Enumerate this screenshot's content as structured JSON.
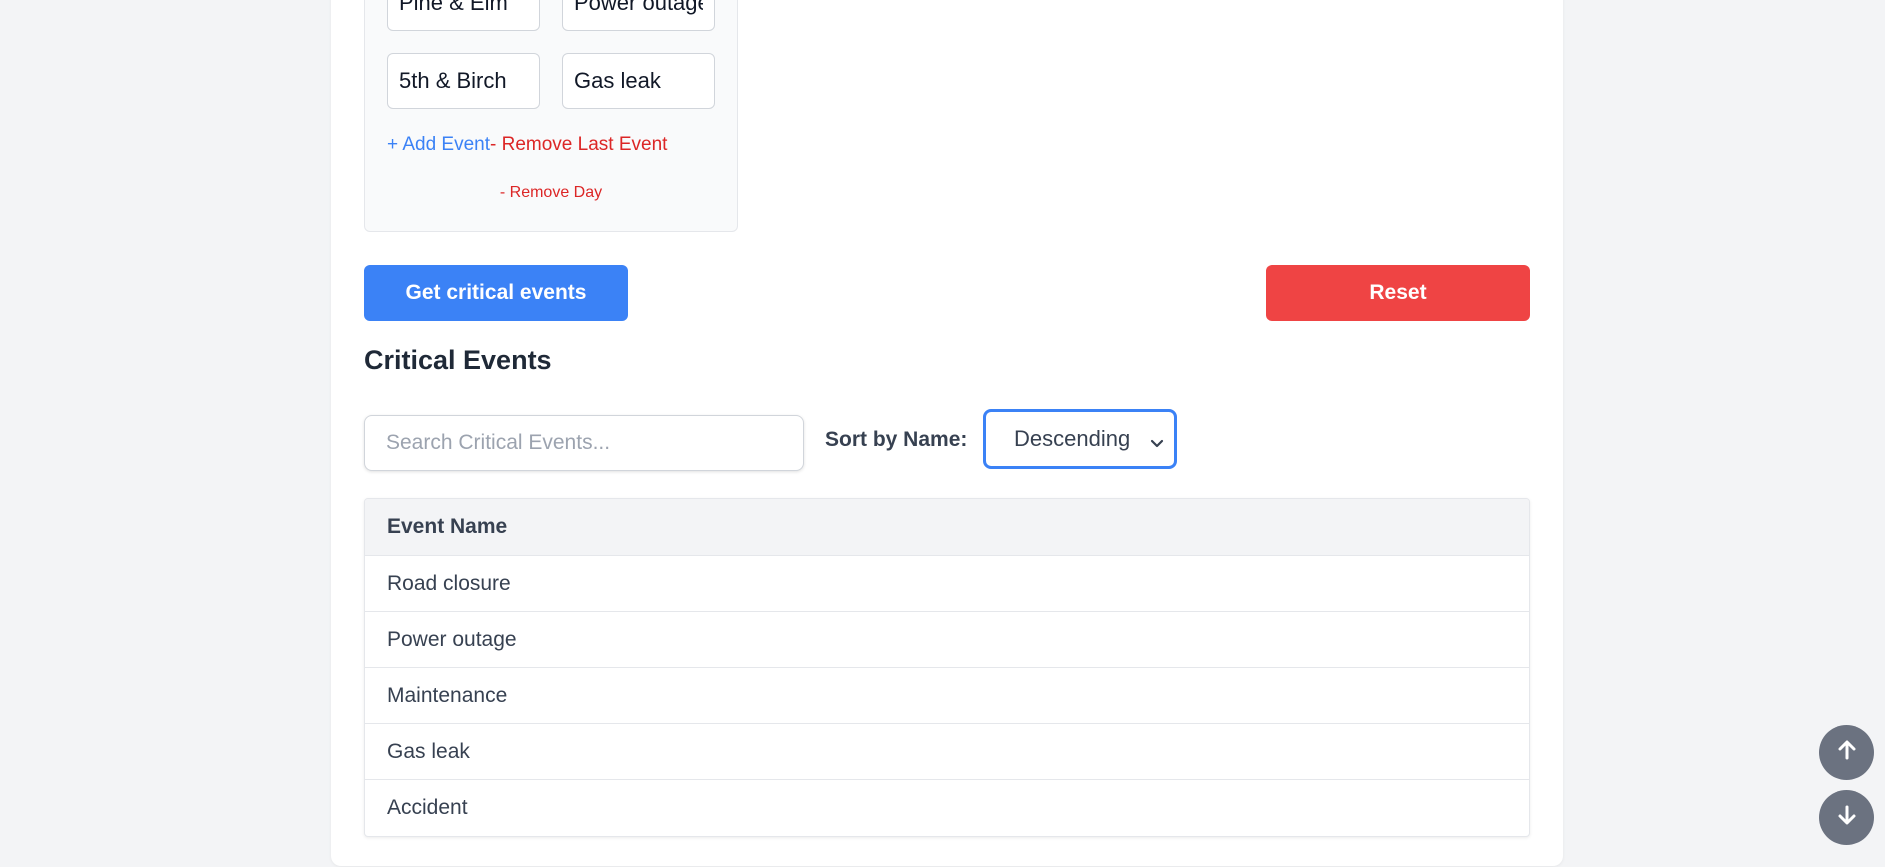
{
  "day": {
    "events": [
      {
        "location": "Pine & Elm",
        "event": "Power outage"
      },
      {
        "location": "5th & Birch",
        "event": "Gas leak"
      }
    ],
    "add_event_label": "+ Add Event",
    "remove_last_event_label": "- Remove Last Event",
    "remove_day_label": "- Remove Day"
  },
  "actions": {
    "get_critical_label": "Get critical events",
    "reset_label": "Reset"
  },
  "critical": {
    "title": "Critical Events",
    "search_placeholder": "Search Critical Events...",
    "sort_label": "Sort by Name:",
    "sort_value": "Descending",
    "table_header": "Event Name",
    "rows": [
      "Road closure",
      "Power outage",
      "Maintenance",
      "Gas leak",
      "Accident"
    ]
  },
  "colors": {
    "primary": "#3b82f6",
    "danger": "#ef4444"
  },
  "icons": {
    "scroll_up": "arrow-up-icon",
    "scroll_down": "arrow-down-icon",
    "select": "chevron-down-icon"
  }
}
